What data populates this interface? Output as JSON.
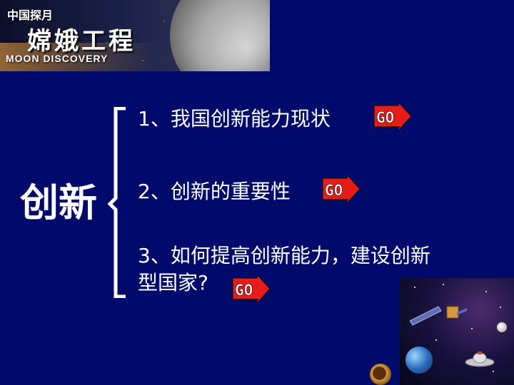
{
  "banner": {
    "small_title": "中国探月",
    "big_title": "嫦娥工程",
    "subtitle": "MOON DISCOVERY"
  },
  "keyword": "创新",
  "items": [
    {
      "text": "1、我国创新能力现状",
      "button": "GO"
    },
    {
      "text": "2、创新的重要性",
      "button": "GO"
    },
    {
      "text_line1": "3、如何提高创新能力，建设创新",
      "text_line2": "型国家?",
      "button": "GO"
    }
  ],
  "colors": {
    "background": "#000a6a",
    "text": "#ffffff",
    "go_red": "#e81b1b"
  }
}
